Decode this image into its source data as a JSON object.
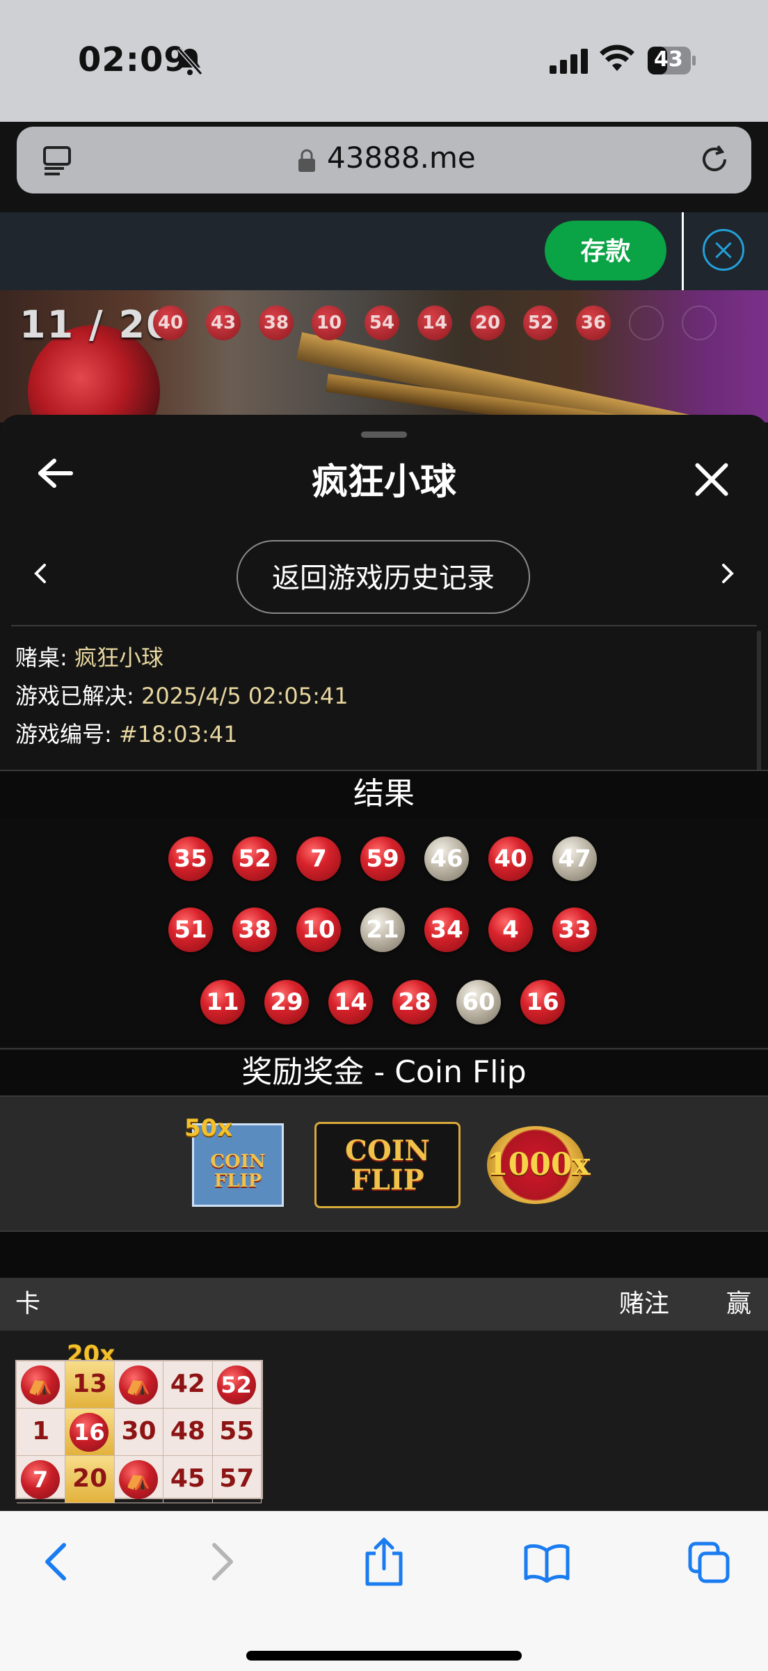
{
  "status_bar": {
    "time": "02:09",
    "battery": "43"
  },
  "browser": {
    "domain": "43888.me"
  },
  "site_header": {
    "deposit_label": "存款"
  },
  "live": {
    "counter": "11 / 20",
    "drawn_balls": [
      "40",
      "43",
      "38",
      "10",
      "54",
      "14",
      "20",
      "52",
      "36"
    ]
  },
  "sheet": {
    "title": "疯狂小球",
    "history_button": "返回游戏历史记录",
    "info": {
      "table_label": "赌桌: ",
      "table_value": "疯狂小球",
      "resolved_label": "游戏已解决: ",
      "resolved_value": "2025/4/5 02:05:41",
      "game_id_label": "游戏编号: ",
      "game_id_value": "#18:03:41"
    },
    "results_title": "结果",
    "result_rows": [
      [
        {
          "n": "35",
          "c": "red"
        },
        {
          "n": "52",
          "c": "red"
        },
        {
          "n": "7",
          "c": "red"
        },
        {
          "n": "59",
          "c": "red"
        },
        {
          "n": "46",
          "c": "silver"
        },
        {
          "n": "40",
          "c": "red"
        },
        {
          "n": "47",
          "c": "silver"
        }
      ],
      [
        {
          "n": "51",
          "c": "red"
        },
        {
          "n": "38",
          "c": "red"
        },
        {
          "n": "10",
          "c": "red"
        },
        {
          "n": "21",
          "c": "silver"
        },
        {
          "n": "34",
          "c": "red"
        },
        {
          "n": "4",
          "c": "red"
        },
        {
          "n": "33",
          "c": "red"
        }
      ],
      [
        {
          "n": "11",
          "c": "red"
        },
        {
          "n": "29",
          "c": "red"
        },
        {
          "n": "14",
          "c": "red"
        },
        {
          "n": "28",
          "c": "red"
        },
        {
          "n": "60",
          "c": "silver"
        },
        {
          "n": "16",
          "c": "red"
        }
      ]
    ],
    "bonus_title": "奖励奖金 - Coin Flip",
    "bonus": {
      "ticket_mult": "50x",
      "ticket_text": "COIN FLIP",
      "frame_text": "COIN FLIP",
      "coin_mult": "1000x"
    },
    "table_head": {
      "card": "卡",
      "bet": "赌注",
      "win": "赢"
    },
    "card": {
      "multiplier": "20x",
      "rows": [
        [
          "⛺",
          "13",
          "⛺",
          "42",
          "52"
        ],
        [
          "1",
          "16",
          "30",
          "48",
          "55"
        ],
        [
          "7",
          "20",
          "⛺",
          "45",
          "57"
        ]
      ]
    }
  },
  "colors": {
    "accent_green": "#0aa345",
    "ball_red": "#d7222b",
    "ball_silver": "#bdb6a6",
    "gold": "#f4c12a"
  }
}
